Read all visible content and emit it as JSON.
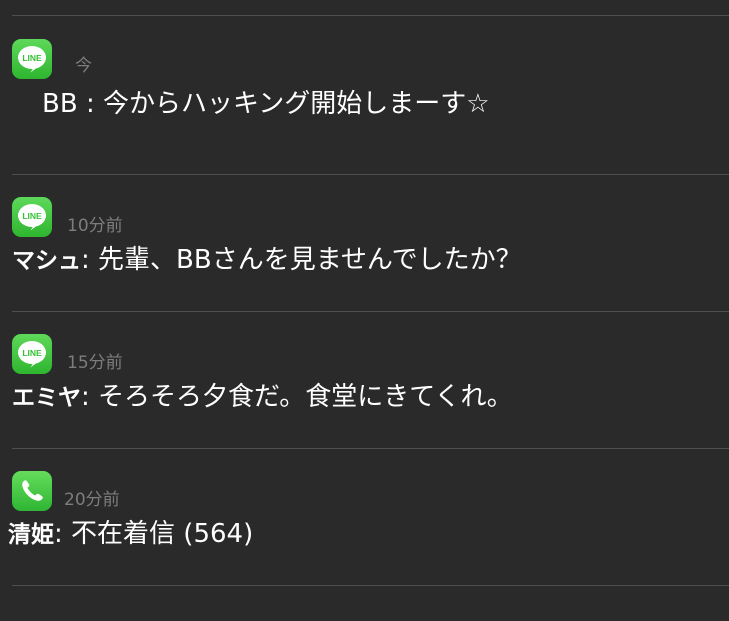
{
  "notifications": [
    {
      "app": "LINE",
      "icon": "line-app-icon",
      "time": "今",
      "sender": "BB",
      "separator": " : ",
      "message": "今からハッキング開始しまーす☆"
    },
    {
      "app": "LINE",
      "icon": "line-app-icon",
      "time": "10分前",
      "sender": "マシュ",
      "separator": ": ",
      "message": "先輩、BBさんを見ませんでしたか？"
    },
    {
      "app": "LINE",
      "icon": "line-app-icon",
      "time": "15分前",
      "sender": "エミヤ",
      "separator": ": ",
      "message": "そろそろ夕食だ。食堂にきてくれ。"
    },
    {
      "app": "Phone",
      "icon": "phone-app-icon",
      "time": "20分前",
      "sender": "清姫",
      "separator": ": ",
      "message": "不在着信 (564)"
    }
  ],
  "colors": {
    "background": "#2a2a2a",
    "divider": "#4e4e4e",
    "line_green": "#3cc83c",
    "phone_green": "#46c846",
    "time_text": "#7d7d7d",
    "message_text": "#ffffff"
  }
}
